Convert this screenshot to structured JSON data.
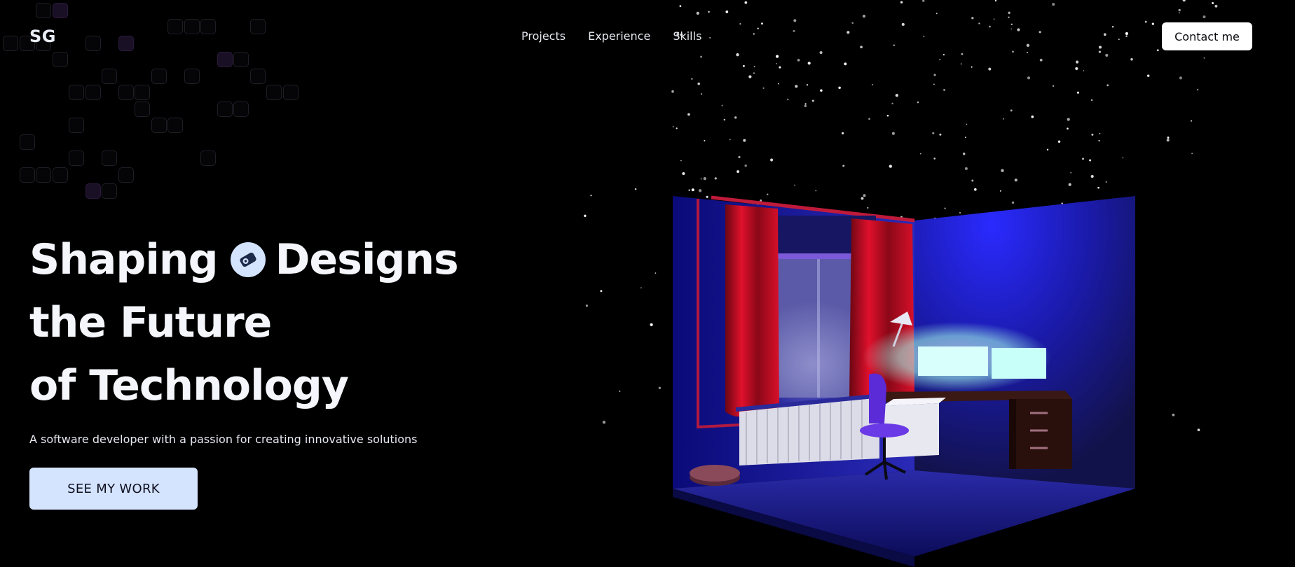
{
  "header": {
    "logo": "SG",
    "nav": [
      "Projects",
      "Experience",
      "Skills"
    ],
    "contact_label": "Contact me"
  },
  "hero": {
    "title_line1_a": "Shaping",
    "title_line1_b": "Designs",
    "title_line2": "the Future",
    "title_line3": "of Technology",
    "subtitle": "A software developer with a passion for creating innovative solutions",
    "cta_label": "SEE MY WORK"
  },
  "icons": {
    "title_badge": "swatch-icon"
  },
  "colors": {
    "background": "#000000",
    "accent": "#d4e4ff",
    "room_wall": "#1c1cc8",
    "curtain": "#c8102a",
    "chair": "#5a2bd6",
    "monitor_glow": "#bffaf2"
  }
}
